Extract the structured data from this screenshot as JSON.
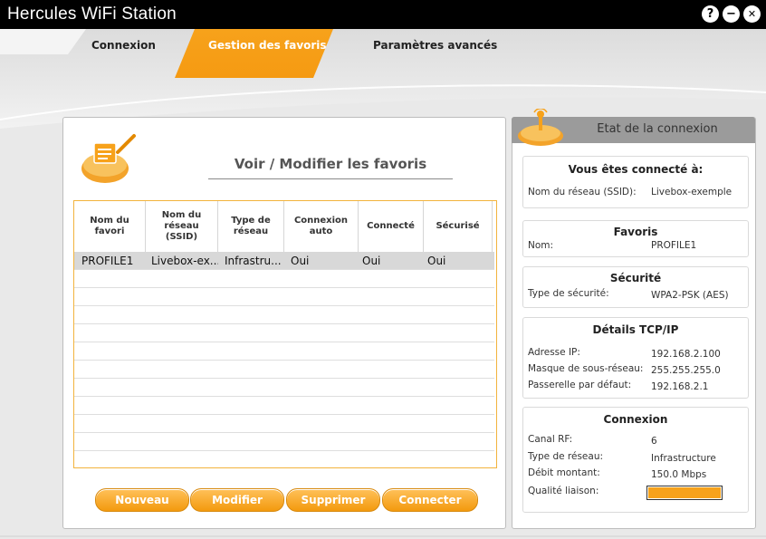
{
  "window": {
    "title": "Hercules WiFi Station",
    "help_glyph": "?",
    "minimize_glyph": "−",
    "close_glyph": "✕"
  },
  "tabs": [
    {
      "label": "Connexion",
      "active": false
    },
    {
      "label": "Gestion des favoris",
      "active": true
    },
    {
      "label": "Paramètres avancés",
      "active": false
    }
  ],
  "favorites": {
    "title": "Voir / Modifier les favoris",
    "icon": "favorites-icon",
    "columns": [
      "Nom du\nfavori",
      "Nom du\nréseau\n(SSID)",
      "Type de\nréseau",
      "Connexion\nauto",
      "Connecté",
      "Sécurisé"
    ],
    "rows": [
      [
        "PROFILE1",
        "Livebox-ex...",
        "Infrastru...",
        "Oui",
        "Oui",
        "Oui"
      ]
    ],
    "buttons": {
      "new": "Nouveau",
      "edit": "Modifier",
      "delete": "Supprimer",
      "connect": "Connecter"
    }
  },
  "status": {
    "title": "Etat de la connexion",
    "icon": "connection-status-icon",
    "connected": {
      "title": "Vous êtes connecté à:",
      "ssid_label": "Nom du réseau (SSID):",
      "ssid_value": "Livebox-exemple"
    },
    "favorites": {
      "title": "Favoris",
      "name_label": "Nom:",
      "name_value": "PROFILE1"
    },
    "security": {
      "title": "Sécurité",
      "type_label": "Type de sécurité:",
      "type_value": "WPA2-PSK (AES)"
    },
    "tcpip": {
      "title": "Détails TCP/IP",
      "ip_label": "Adresse IP:",
      "ip_value": "192.168.2.100",
      "mask_label": "Masque de sous-réseau:",
      "mask_value": "255.255.255.0",
      "gateway_label": "Passerelle par défaut:",
      "gateway_value": "192.168.2.1"
    },
    "connection": {
      "title": "Connexion",
      "channel_label": "Canal RF:",
      "channel_value": "6",
      "network_type_label": "Type de réseau:",
      "network_type_value": "Infrastructure",
      "uplink_label": "Débit montant:",
      "uplink_value": "150.0 Mbps",
      "quality_label": "Qualité liaison:",
      "quality_level": 1.0
    }
  },
  "colors": {
    "accent": "#f7a21b",
    "titlebar": "#000000",
    "panel_header": "#9b9b9b"
  }
}
